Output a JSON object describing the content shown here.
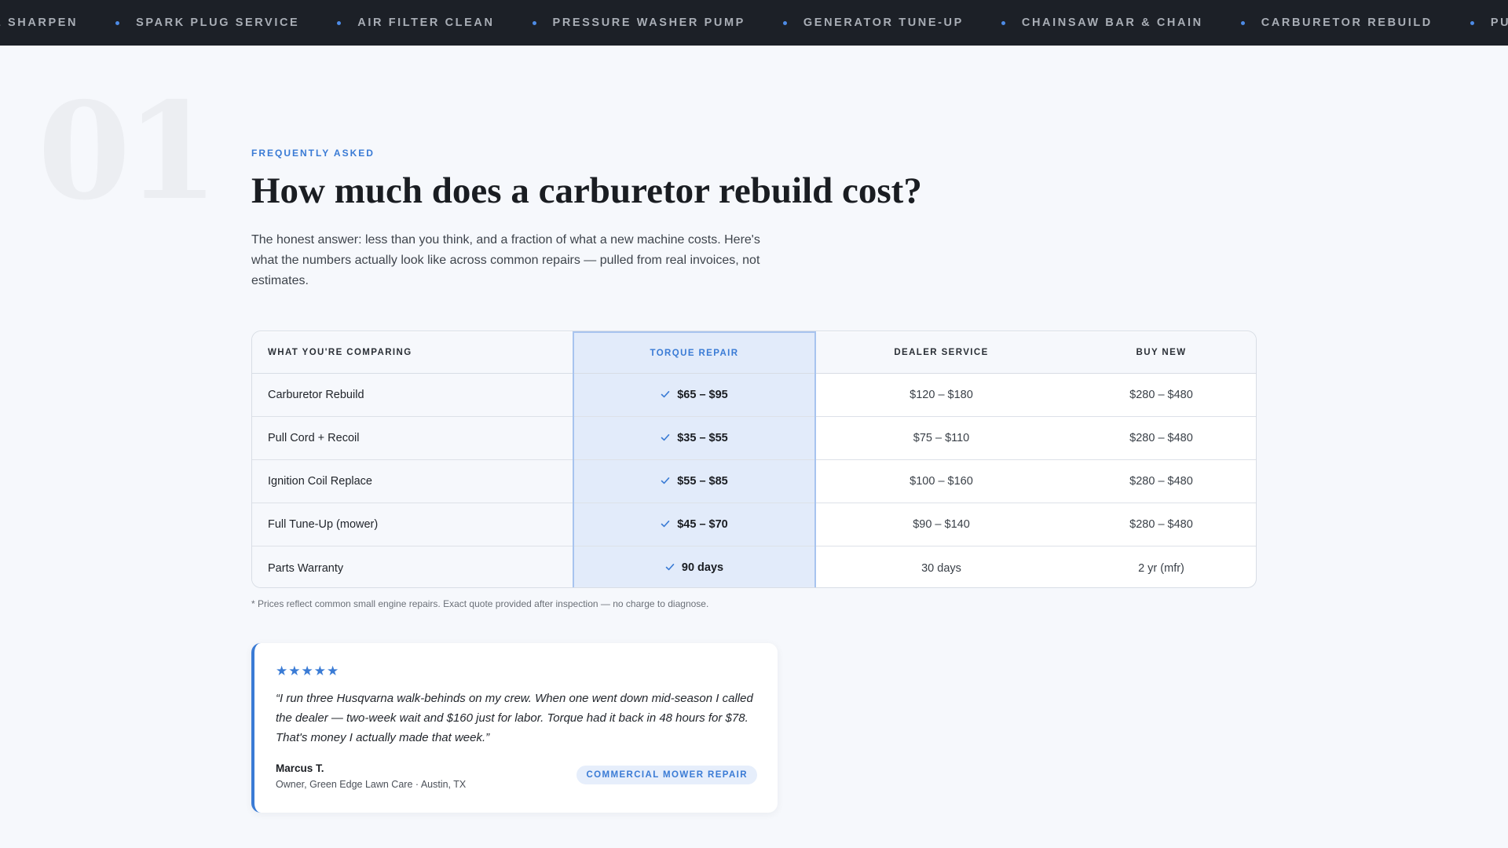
{
  "ticker": {
    "items": [
      "DE SHARPEN",
      "SPARK PLUG SERVICE",
      "AIR FILTER CLEAN",
      "PRESSURE WASHER PUMP",
      "GENERATOR TUNE-UP",
      "CHAINSAW BAR & CHAIN",
      "CARBURETOR REBUILD",
      "PULL CORD RESTRING"
    ]
  },
  "section": {
    "number": "01",
    "eyebrow": "FREQUENTLY ASKED",
    "title": "How much does a carburetor rebuild cost?",
    "lead": "The honest answer: less than you think, and a fraction of what a new machine costs. Here's what the numbers actually look like across common repairs — pulled from real invoices, not estimates."
  },
  "comparison": {
    "headers": [
      "WHAT YOU'RE COMPARING",
      "TORQUE REPAIR",
      "DEALER SERVICE",
      "BUY NEW"
    ],
    "rows": [
      {
        "label": "Carburetor Rebuild",
        "torque": "$65 – $95",
        "dealer": "$120 – $180",
        "new": "$280 – $480"
      },
      {
        "label": "Pull Cord + Recoil",
        "torque": "$35 – $55",
        "dealer": "$75 – $110",
        "new": "$280 – $480"
      },
      {
        "label": "Ignition Coil Replace",
        "torque": "$55 – $85",
        "dealer": "$100 – $160",
        "new": "$280 – $480"
      },
      {
        "label": "Full Tune-Up (mower)",
        "torque": "$45 – $70",
        "dealer": "$90 – $140",
        "new": "$280 – $480"
      },
      {
        "label": "Parts Warranty",
        "torque": "90 days",
        "dealer": "30 days",
        "new": "2 yr (mfr)"
      }
    ],
    "footnote": "* Prices reflect common small engine repairs. Exact quote provided after inspection — no charge to diagnose.",
    "highlight_color": "#3a7bd5"
  },
  "testimonial": {
    "stars": "★★★★★",
    "rating": 5,
    "quote": "“I run three Husqvarna walk-behinds on my crew. When one went down mid-season I called the dealer — two-week wait and $160 just for labor. Torque had it back in 48 hours for $78. That's money I actually made that week.”",
    "author": "Marcus T.",
    "role": "Owner, Green Edge Lawn Care · Austin, TX",
    "tag": "COMMERCIAL MOWER REPAIR"
  },
  "colors": {
    "accent": "#3a7bd5",
    "ticker_bg": "#1c2027",
    "page_bg": "#f6f8fc"
  }
}
